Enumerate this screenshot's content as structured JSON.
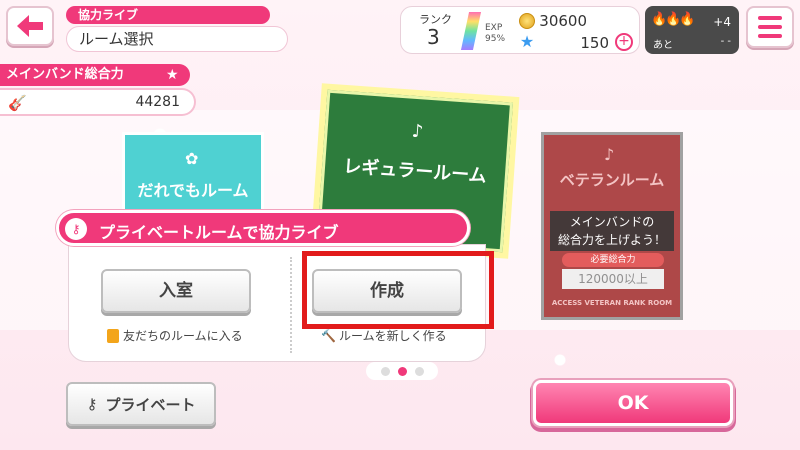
{
  "header": {
    "subtitle": "協力ライブ",
    "title": "ルーム選択",
    "back_icon": "back-arrow-icon",
    "menu_icon": "hamburger-menu-icon"
  },
  "status": {
    "rank_label": "ランク",
    "rank_value": "3",
    "exp_label": "EXP",
    "exp_percent": "95%",
    "coins": "30600",
    "stars": "150",
    "plus_label": "+"
  },
  "energy": {
    "flames": "🔥🔥🔥",
    "extra": "+4",
    "after_label": "あと",
    "time": "- -"
  },
  "band_power": {
    "label": "メインバンド総合力",
    "value": "44281"
  },
  "rooms": {
    "anyone_label": "だれでもルーム",
    "regular_label": "レギュラールーム",
    "veteran_label": "ベテランルーム",
    "veteran_note_line1": "メインバンドの",
    "veteran_note_line2": "総合力を上げよう！",
    "veteran_req_label": "必要総合力",
    "veteran_req_value": "120000以上",
    "veteran_access": "ACCESS VETERAN RANK ROOM"
  },
  "popup": {
    "title": "プライベートルームで協力ライブ",
    "enter_button": "入室",
    "create_button": "作成",
    "enter_hint": "友だちのルームに入る",
    "create_hint": "ルームを新しく作る"
  },
  "bottom": {
    "private_button": "プライベート",
    "ok_button": "OK"
  },
  "colors": {
    "accent": "#f0397a",
    "highlight": "#e21b1b"
  }
}
